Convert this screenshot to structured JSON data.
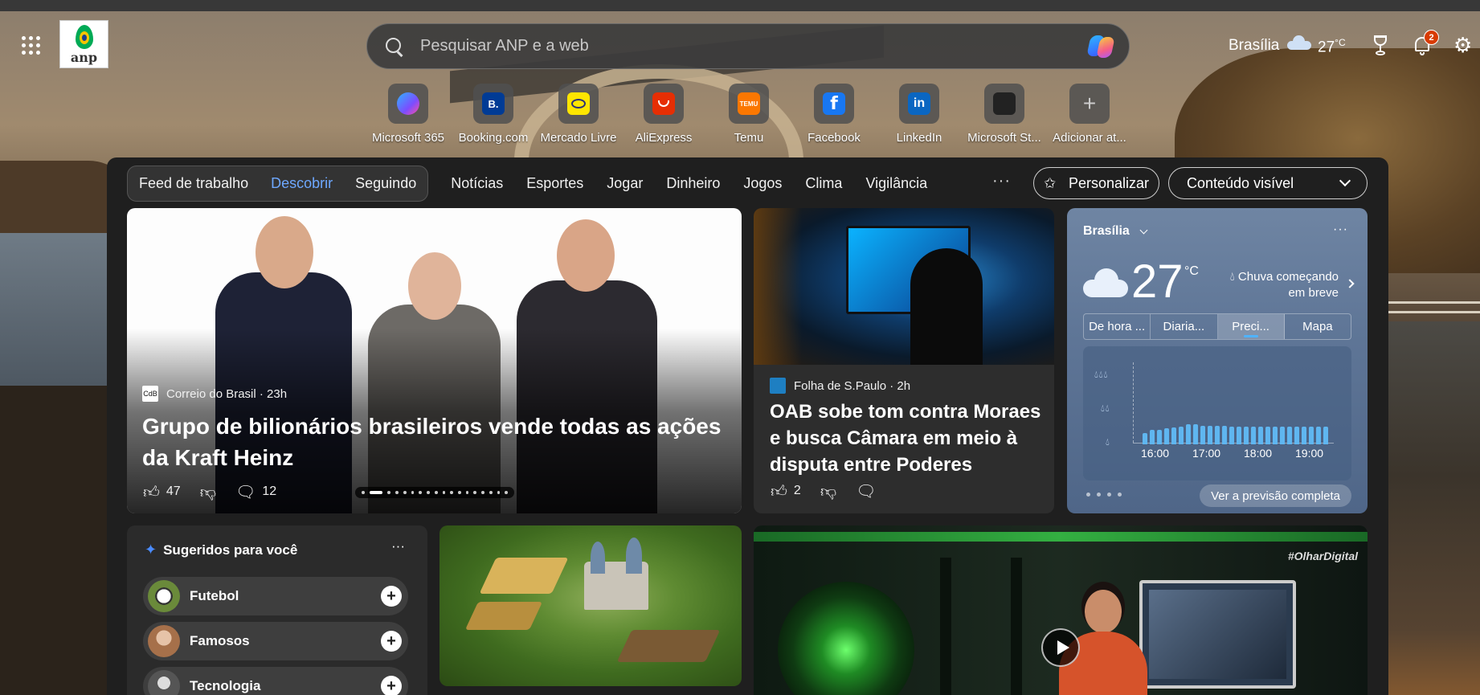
{
  "header": {
    "search_placeholder": "Pesquisar ANP e a web",
    "logo_text": "anp",
    "location": "Brasília",
    "temperature": "27",
    "temperature_unit": "°C",
    "notification_count": "2"
  },
  "quick_links": [
    {
      "label": "Microsoft 365",
      "icon": "microsoft-365-icon",
      "color": "#6a5cff",
      "glyph": ""
    },
    {
      "label": "Booking.com",
      "icon": "booking-icon",
      "color": "#003b95",
      "glyph": "B."
    },
    {
      "label": "Mercado Livre",
      "icon": "mercado-livre-icon",
      "color": "#ffe600",
      "glyph": ""
    },
    {
      "label": "AliExpress",
      "icon": "aliexpress-icon",
      "color": "#e62e04",
      "glyph": ""
    },
    {
      "label": "Temu",
      "icon": "temu-icon",
      "color": "#fb7701",
      "glyph": "TEMU"
    },
    {
      "label": "Facebook",
      "icon": "facebook-icon",
      "color": "#1877f2",
      "glyph": "f"
    },
    {
      "label": "LinkedIn",
      "icon": "linkedin-icon",
      "color": "#0a66c2",
      "glyph": "in"
    },
    {
      "label": "Microsoft St...",
      "icon": "microsoft-store-icon",
      "color": "#222222",
      "glyph": ""
    },
    {
      "label": "Adicionar at...",
      "icon": "plus-icon",
      "color": "transparent",
      "glyph": "+"
    }
  ],
  "nav": {
    "segmented": [
      "Feed de trabalho",
      "Descobrir",
      "Seguindo"
    ],
    "active": "Descobrir",
    "links": [
      "Notícias",
      "Esportes",
      "Jogar",
      "Dinheiro",
      "Jogos",
      "Clima",
      "Vigilância"
    ],
    "more": "···",
    "personalize_label": "Personalizar",
    "content_visible_label": "Conteúdo visível"
  },
  "hero": {
    "source": "Correio do Brasil",
    "source_logo": "CdB",
    "age": "23h",
    "source_line": "Correio do Brasil · 23h",
    "headline": "Grupo de bilionários brasileiros vende todas as ações da Kraft Heinz",
    "likes": "47",
    "comments": "12"
  },
  "card2": {
    "source": "Folha de S.Paulo",
    "source_line": "Folha de S.Paulo · 2h",
    "headline": "OAB sobe tom contra Moraes e busca Câmara em meio à disputa entre Poderes",
    "likes": "2"
  },
  "weather": {
    "city": "Brasília",
    "temp": "27",
    "unit": "°C",
    "condition": "Chuva começando em breve",
    "tabs": [
      "De hora ...",
      "Diaria...",
      "Preci...",
      "Mapa"
    ],
    "active_tab": "Preci...",
    "x_labels": [
      "16:00",
      "17:00",
      "18:00",
      "19:00"
    ],
    "precip_levels": [
      0.55,
      0.7,
      0.7,
      0.75,
      0.8,
      0.85,
      0.95,
      0.95,
      0.9,
      0.9,
      0.9,
      0.9,
      0.85,
      0.85,
      0.85,
      0.85,
      0.85,
      0.85,
      0.85,
      0.85,
      0.85,
      0.85,
      0.85,
      0.85,
      0.85,
      0.85
    ],
    "full_forecast_label": "Ver a previsão completa"
  },
  "suggestions": {
    "title": "Sugeridos para você",
    "items": [
      "Futebol",
      "Famosos",
      "Tecnologia"
    ]
  },
  "video": {
    "tag": "#OlharDigital"
  },
  "colors": {
    "accent": "#6ea8ff",
    "badge": "#d83b01",
    "precip_bar": "#5fb6f0"
  }
}
